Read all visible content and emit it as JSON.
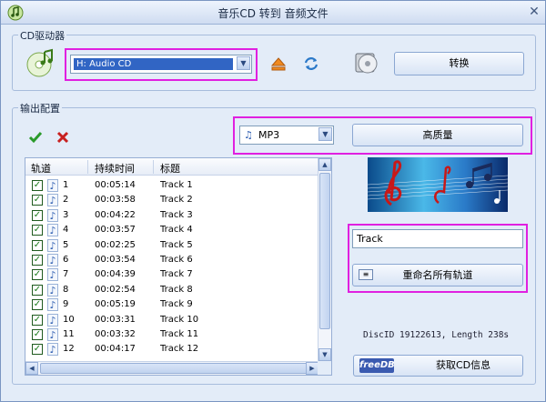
{
  "window": {
    "title": "音乐CD 转到 音频文件",
    "close_glyph": "✕"
  },
  "cd_drive": {
    "group_label": "CD驱动器",
    "selected_drive": "H:  Audio CD",
    "convert_label": "转换"
  },
  "output": {
    "group_label": "输出配置",
    "format_selected": "MP3",
    "quality_label": "高质量"
  },
  "tracks": {
    "columns": [
      "轨道",
      "持续时间",
      "标题"
    ],
    "rows": [
      {
        "num": "1",
        "duration": "00:05:14",
        "title": "Track 1"
      },
      {
        "num": "2",
        "duration": "00:03:58",
        "title": "Track 2"
      },
      {
        "num": "3",
        "duration": "00:04:22",
        "title": "Track 3"
      },
      {
        "num": "4",
        "duration": "00:03:57",
        "title": "Track 4"
      },
      {
        "num": "5",
        "duration": "00:02:25",
        "title": "Track 5"
      },
      {
        "num": "6",
        "duration": "00:03:54",
        "title": "Track 6"
      },
      {
        "num": "7",
        "duration": "00:04:39",
        "title": "Track 7"
      },
      {
        "num": "8",
        "duration": "00:02:54",
        "title": "Track 8"
      },
      {
        "num": "9",
        "duration": "00:05:19",
        "title": "Track 9"
      },
      {
        "num": "10",
        "duration": "00:03:31",
        "title": "Track 10"
      },
      {
        "num": "11",
        "duration": "00:03:32",
        "title": "Track 11"
      },
      {
        "num": "12",
        "duration": "00:04:17",
        "title": "Track 12"
      }
    ]
  },
  "rename": {
    "input_value": "Track",
    "button_label": "重命名所有轨道"
  },
  "disc_info": "DiscID 19122613, Length 238s",
  "freedb": {
    "logo": "freeDB",
    "button_label": "获取CD信息"
  },
  "colors": {
    "highlight": "#e020e0",
    "accent": "#3165c4"
  }
}
